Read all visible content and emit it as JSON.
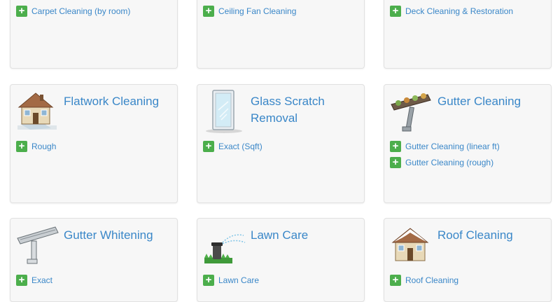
{
  "colors": {
    "link": "#3a87c8",
    "plus_button": "#4cae4c",
    "card_bg": "#f7f7f7"
  },
  "cards": [
    {
      "title": "",
      "icon": "",
      "items": [
        "Carpet Cleaning (by room)"
      ]
    },
    {
      "title": "",
      "icon": "",
      "items": [
        "Ceiling Fan Cleaning"
      ]
    },
    {
      "title": "",
      "icon": "",
      "items": [
        "Deck Cleaning & Restoration"
      ]
    },
    {
      "title": "Flatwork Cleaning",
      "icon": "house-icon",
      "items": [
        "Rough"
      ]
    },
    {
      "title": "Glass Scratch Removal",
      "icon": "window-icon",
      "items": [
        "Exact (Sqft)"
      ]
    },
    {
      "title": "Gutter Cleaning",
      "icon": "gutter-icon",
      "items": [
        "Gutter Cleaning (linear ft)",
        "Gutter Cleaning (rough)"
      ]
    },
    {
      "title": "Gutter Whitening",
      "icon": "gutter-pipe-icon",
      "items": [
        "Exact"
      ]
    },
    {
      "title": "Lawn Care",
      "icon": "sprinkler-icon",
      "items": [
        "Lawn Care"
      ]
    },
    {
      "title": "Roof Cleaning",
      "icon": "snowy-house-icon",
      "items": [
        "Roof Cleaning"
      ]
    }
  ]
}
